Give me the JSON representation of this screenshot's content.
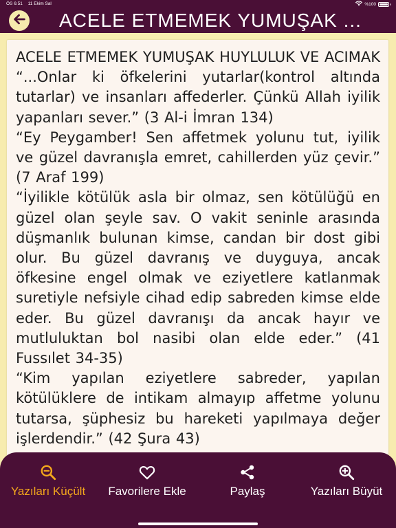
{
  "status_bar": {
    "time": "ÖS 6:51",
    "date": "11 Ekim Sal",
    "battery_text": "%100",
    "battery_level": 1.0,
    "icons": [
      "wifi-icon",
      "battery-icon"
    ]
  },
  "nav": {
    "back_icon": "arrow-left-icon",
    "title": "ACELE ETMEMEK YUMUŞAK ..."
  },
  "article": {
    "paragraphs": [
      "ACELE ETMEMEK YUMUŞAK HUYLULUK VE ACIMAK",
      "“...Onlar ki öfkelerini yutarlar(kontrol altında tutarlar) ve insanları affederler. Çünkü Allah iyilik yapanları sever.” (3 Al-i İmran 134)",
      "“Ey Peygamber! Sen affetmek yolunu tut, iyilik ve güzel davranışla emret, cahillerden yüz çevir.” (7 Araf 199)",
      "“İyilikle kötülük asla bir olmaz, sen kötülüğü en güzel olan şeyle sav. O vakit seninle arasında düşmanlık bulunan kimse, candan bir dost gibi olur. Bu güzel davranış ve duyguya, ancak öfkesine engel olmak ve eziyetlere katlanmak suretiyle nefsiyle cihad edip sabreden kimse elde eder. Bu güzel davranışı da ancak hayır ve mutluluktan bol nasibi olan elde eder.” (41 Fussılet 34-35)",
      "“Kim yapılan eziyetlere sabreder, yapılan kötülüklere de intikam almayıp affetme yolunu tutarsa, şüphesiz bu hareketi yapılmaya değer işlerdendir.” (42 Şura 43)"
    ]
  },
  "tabs": [
    {
      "label": "Yazıları Küçült",
      "icon": "zoom-out-icon",
      "active": true
    },
    {
      "label": "Favorilere Ekle",
      "icon": "heart-icon",
      "active": false
    },
    {
      "label": "Paylaş",
      "icon": "share-icon",
      "active": false
    },
    {
      "label": "Yazıları Büyüt",
      "icon": "zoom-in-icon",
      "active": false
    }
  ],
  "colors": {
    "header_bg": "#4a0f36",
    "page_bg": "#f7ecaf",
    "card_bg": "#fcf5ef",
    "accent": "#f4a81c",
    "text": "#1f1f1f"
  }
}
